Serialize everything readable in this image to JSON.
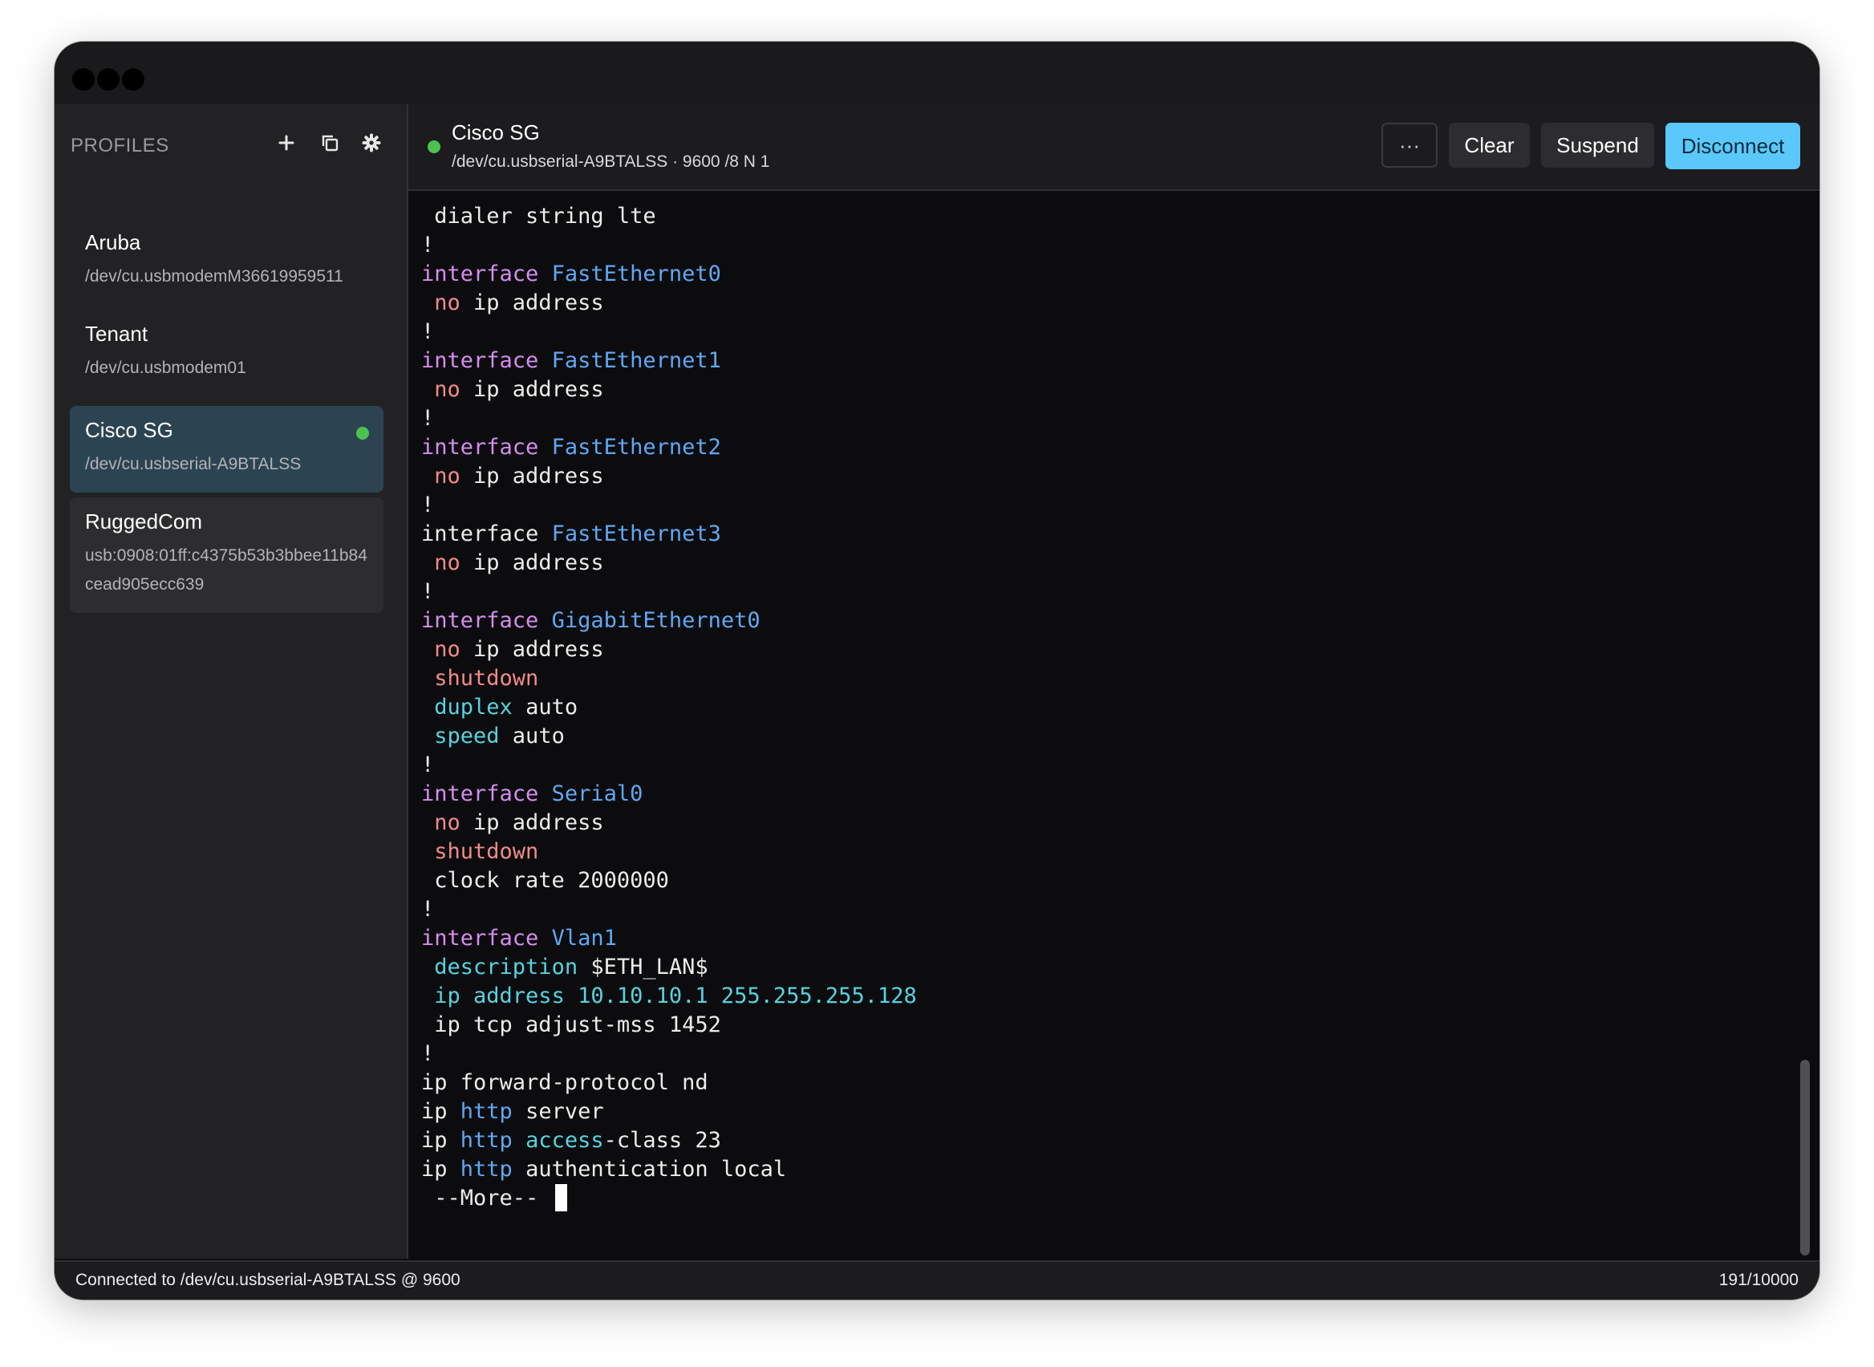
{
  "sidebar": {
    "header": "PROFILES",
    "profiles": [
      {
        "name": "Aruba",
        "path": "/dev/cu.usbmodemM36619959511"
      },
      {
        "name": "Tenant",
        "path": "/dev/cu.usbmodem01"
      },
      {
        "name": "Cisco SG",
        "path": "/dev/cu.usbserial-A9BTALSS"
      },
      {
        "name": "RuggedCom",
        "path": "usb:0908:01ff:c4375b53b3bbee11b84cead905ecc639"
      }
    ]
  },
  "header": {
    "title": "Cisco SG",
    "subtitle": "/dev/cu.usbserial-A9BTALSS · 9600 /8 N 1",
    "more_label": "···",
    "clear_label": "Clear",
    "suspend_label": "Suspend",
    "disconnect_label": "Disconnect"
  },
  "terminal": {
    "lines": [
      [
        {
          "t": " dialer string lte"
        }
      ],
      [
        {
          "t": "!"
        }
      ],
      [
        {
          "t": "interface ",
          "c": "kw"
        },
        {
          "t": "FastEthernet0",
          "c": "if"
        }
      ],
      [
        {
          "t": " "
        },
        {
          "t": "no",
          "c": "no"
        },
        {
          "t": " ip address"
        }
      ],
      [
        {
          "t": "!"
        }
      ],
      [
        {
          "t": "interface ",
          "c": "kw"
        },
        {
          "t": "FastEthernet1",
          "c": "if"
        }
      ],
      [
        {
          "t": " "
        },
        {
          "t": "no",
          "c": "no"
        },
        {
          "t": " ip address"
        }
      ],
      [
        {
          "t": "!"
        }
      ],
      [
        {
          "t": "interface ",
          "c": "kw"
        },
        {
          "t": "FastEthernet2",
          "c": "if"
        }
      ],
      [
        {
          "t": " "
        },
        {
          "t": "no",
          "c": "no"
        },
        {
          "t": " ip address"
        }
      ],
      [
        {
          "t": "!"
        }
      ],
      [
        {
          "t": "interface "
        },
        {
          "t": "FastEthernet3",
          "c": "if"
        }
      ],
      [
        {
          "t": " "
        },
        {
          "t": "no",
          "c": "no"
        },
        {
          "t": " ip address"
        }
      ],
      [
        {
          "t": "!"
        }
      ],
      [
        {
          "t": "interface ",
          "c": "kw"
        },
        {
          "t": "GigabitEthernet0",
          "c": "if"
        }
      ],
      [
        {
          "t": " "
        },
        {
          "t": "no",
          "c": "no"
        },
        {
          "t": " ip address"
        }
      ],
      [
        {
          "t": " "
        },
        {
          "t": "shutdown",
          "c": "sd"
        }
      ],
      [
        {
          "t": " "
        },
        {
          "t": "duplex",
          "c": "cy"
        },
        {
          "t": " auto"
        }
      ],
      [
        {
          "t": " "
        },
        {
          "t": "speed",
          "c": "cy"
        },
        {
          "t": " auto"
        }
      ],
      [
        {
          "t": "!"
        }
      ],
      [
        {
          "t": "interface ",
          "c": "kw"
        },
        {
          "t": "Serial0",
          "c": "if"
        }
      ],
      [
        {
          "t": " "
        },
        {
          "t": "no",
          "c": "no"
        },
        {
          "t": " ip address"
        }
      ],
      [
        {
          "t": " "
        },
        {
          "t": "shutdown",
          "c": "sd"
        }
      ],
      [
        {
          "t": " clock rate 2000000"
        }
      ],
      [
        {
          "t": "!"
        }
      ],
      [
        {
          "t": "interface ",
          "c": "kw"
        },
        {
          "t": "Vlan1",
          "c": "if"
        }
      ],
      [
        {
          "t": " "
        },
        {
          "t": "description",
          "c": "cy"
        },
        {
          "t": " $ETH_LAN$"
        }
      ],
      [
        {
          "t": " "
        },
        {
          "t": "ip address 10.10.10.1 255.255.255.128",
          "c": "cy"
        }
      ],
      [
        {
          "t": " ip tcp adjust-mss 1452"
        }
      ],
      [
        {
          "t": "!"
        }
      ],
      [
        {
          "t": "ip forward-protocol nd"
        }
      ],
      [
        {
          "t": "ip "
        },
        {
          "t": "http",
          "c": "bl"
        },
        {
          "t": " server"
        }
      ],
      [
        {
          "t": "ip "
        },
        {
          "t": "http",
          "c": "bl"
        },
        {
          "t": " "
        },
        {
          "t": "access",
          "c": "cy"
        },
        {
          "t": "-class 23"
        }
      ],
      [
        {
          "t": "ip "
        },
        {
          "t": "http",
          "c": "bl"
        },
        {
          "t": " authentication local"
        }
      ]
    ],
    "prompt": " --More-- "
  },
  "status": {
    "left": "Connected to /dev/cu.usbserial-A9BTALSS @ 9600",
    "right": "191/10000"
  },
  "colors": {
    "accent": "#5ac8fa",
    "connected": "#4cc24e",
    "keyword": "#d78cf0",
    "interface": "#5fa8f5",
    "negation": "#f38a8a",
    "parameter": "#57d3e0"
  },
  "icons": [
    "plus-icon",
    "duplicate-icon",
    "gear-icon",
    "more-icon"
  ]
}
